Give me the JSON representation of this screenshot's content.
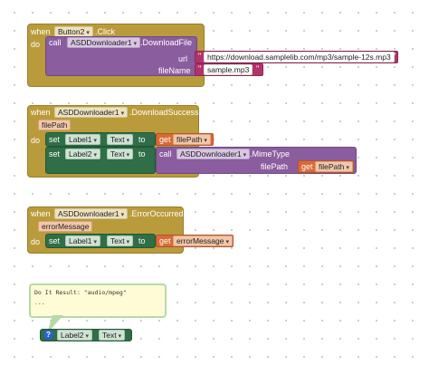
{
  "block1": {
    "when": "when",
    "component": "Button2",
    "event": ".Click",
    "do": "do",
    "call": "call",
    "call_component": "ASDDownloader1",
    "method": ".DownloadFile",
    "url_label": "url",
    "url_value": "https://download.samplelib.com/mp3/sample-12s.mp3",
    "filename_label": "fileName",
    "filename_value": "sample.mp3"
  },
  "block2": {
    "when": "when",
    "component": "ASDDownloader1",
    "event": ".DownloadSuccess",
    "param": "filePath",
    "do": "do",
    "set": "set",
    "to": "to",
    "label1": "Label1",
    "label2": "Label2",
    "prop_text": "Text",
    "get": "get",
    "var": "filePath",
    "call": "call",
    "call_component": "ASDDownloader1",
    "method": ".MimeType",
    "arg_label": "filePath"
  },
  "block3": {
    "when": "when",
    "component": "ASDDownloader1",
    "event": ".ErrorOccurred",
    "param": "errorMessage",
    "do": "do",
    "set": "set",
    "to": "to",
    "label": "Label1",
    "prop_text": "Text",
    "get": "get",
    "var": "errorMessage"
  },
  "comment": {
    "line1": "Do It Result: \"audio/mpeg\"",
    "line2": "..."
  },
  "getter": {
    "help": "?",
    "component": "Label2",
    "prop": "Text"
  },
  "colors": {
    "control": "#b99b3b",
    "procedure": "#8a5d9e",
    "component": "#2f6e46",
    "text": "#b2336a",
    "variable": "#d96a35"
  }
}
